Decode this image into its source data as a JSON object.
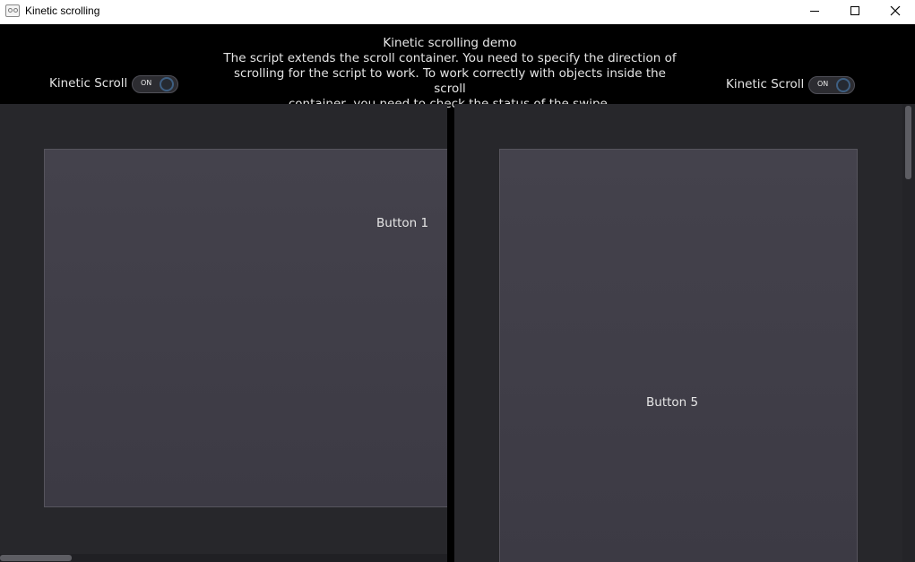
{
  "window": {
    "title": "Kinetic scrolling"
  },
  "header": {
    "title": "Kinetic scrolling demo",
    "desc_lines": [
      "The script extends the scroll container. You need to specify the direction of",
      "scrolling for the script to work. To work correctly with objects inside the scroll",
      "container, you need to check the status of the swipe."
    ]
  },
  "left": {
    "label": "Kinetic Scroll",
    "toggle": "ON",
    "button": "Button 1"
  },
  "right": {
    "label": "Kinetic Scroll",
    "toggle": "ON",
    "button": "Button 5"
  },
  "colors": {
    "toggle_accent": "#3e5f82",
    "panel_bg": "#27272b",
    "card_bg": "#403e48"
  }
}
